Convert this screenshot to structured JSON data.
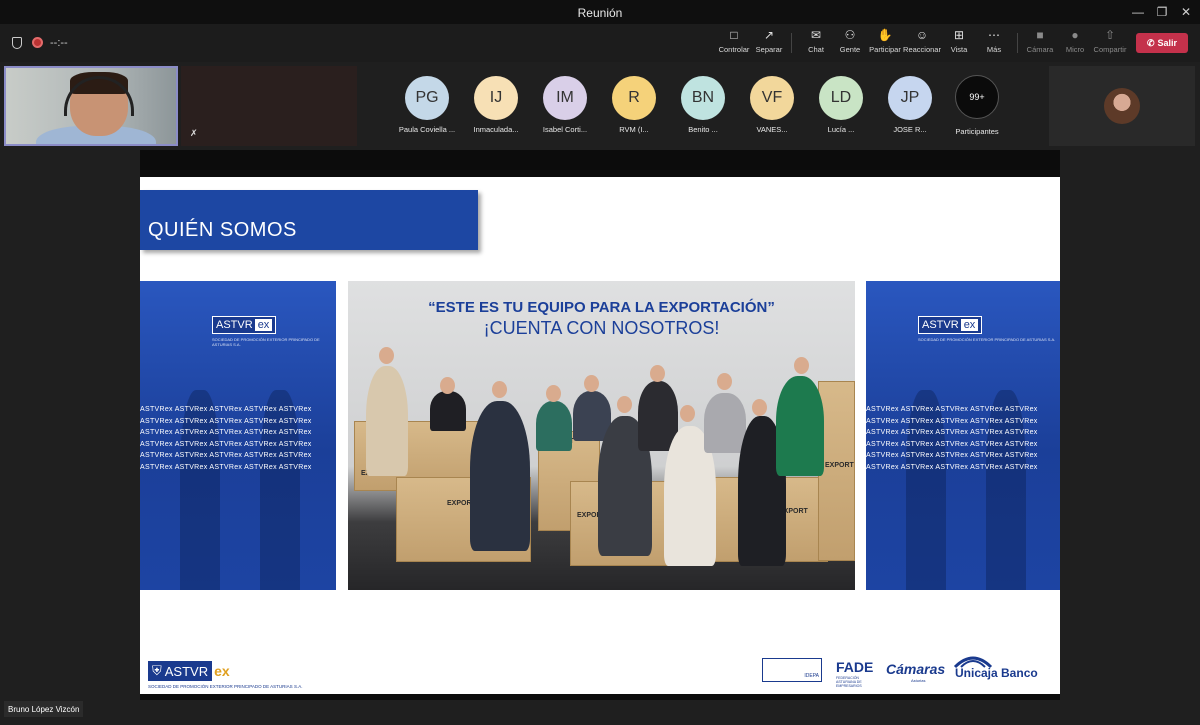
{
  "window": {
    "title": "Reunión",
    "minimize_icon": "minimize-icon",
    "restore_icon": "restore-icon",
    "close_icon": "close-icon"
  },
  "meeting": {
    "timer": "--:--"
  },
  "toolbar": {
    "buttons": [
      {
        "label": "Controlar",
        "icon": "control-icon"
      },
      {
        "label": "Separar",
        "icon": "popout-icon"
      },
      {
        "label": "Chat",
        "icon": "chat-icon"
      },
      {
        "label": "Gente",
        "icon": "people-icon"
      },
      {
        "label": "Participar",
        "icon": "raise-hand-icon"
      },
      {
        "label": "Reaccionar",
        "icon": "react-icon"
      },
      {
        "label": "Vista",
        "icon": "view-icon"
      },
      {
        "label": "Más",
        "icon": "more-icon"
      },
      {
        "label": "Cámara",
        "icon": "camera-off-icon"
      },
      {
        "label": "Micro",
        "icon": "mic-off-icon"
      },
      {
        "label": "Compartir",
        "icon": "share-icon"
      }
    ],
    "leave_label": "Salir"
  },
  "participants": [
    {
      "initials": "PG",
      "name": "Paula Coviella ...",
      "color": "#c4d8e8"
    },
    {
      "initials": "IJ",
      "name": "Inmaculada...",
      "color": "#f7e0b5"
    },
    {
      "initials": "IM",
      "name": "Isabel Corti...",
      "color": "#d9cfe8"
    },
    {
      "initials": "R",
      "name": "RVM (I...",
      "color": "#f5d27a"
    },
    {
      "initials": "BN",
      "name": "Benito ...",
      "color": "#bfe3e0"
    },
    {
      "initials": "VF",
      "name": "VANES...",
      "color": "#f2d79b"
    },
    {
      "initials": "LD",
      "name": "Lucía ...",
      "color": "#c9e4c5"
    },
    {
      "initials": "JP",
      "name": "JOSE R...",
      "color": "#c6d6ef"
    }
  ],
  "participants_count": {
    "badge": "99+",
    "label": "Participantes"
  },
  "slide": {
    "title": "QUIÉN SOMOS",
    "quote_line1": "“ESTE ES TU EQUIPO PARA LA EXPORTACIÓN”",
    "quote_line2": "¡CUENTA CON NOSOTROS!",
    "crate_label": "EXPORT",
    "panel_logo_main": "ASTVR",
    "panel_logo_ex": "ex",
    "panel_logo_sub": "SOCIEDAD DE PROMOCIÓN EXTERIOR PRINCIPADO DE ASTURIAS S.A.",
    "band_text": "ASTVRex ASTVRex ASTVRex ASTVRex ASTVRex",
    "footer_logo_main": "ASTVR",
    "footer_logo_ex": "ex",
    "footer_logo_sub": "SOCIEDAD DE PROMOCIÓN EXTERIOR PRINCIPADO DE ASTURIAS S.A.",
    "partner_idepa": "IDEPA",
    "partner_fade": "FADE",
    "partner_fade_sub": "FEDERACIÓN ASTURIANA DE EMPRESARIOS",
    "partner_camaras": "Cámaras",
    "partner_camaras_sub": "Asturias",
    "partner_unicaja": "Unicaja Banco"
  },
  "presenter_name": "Bruno López Vizcón"
}
